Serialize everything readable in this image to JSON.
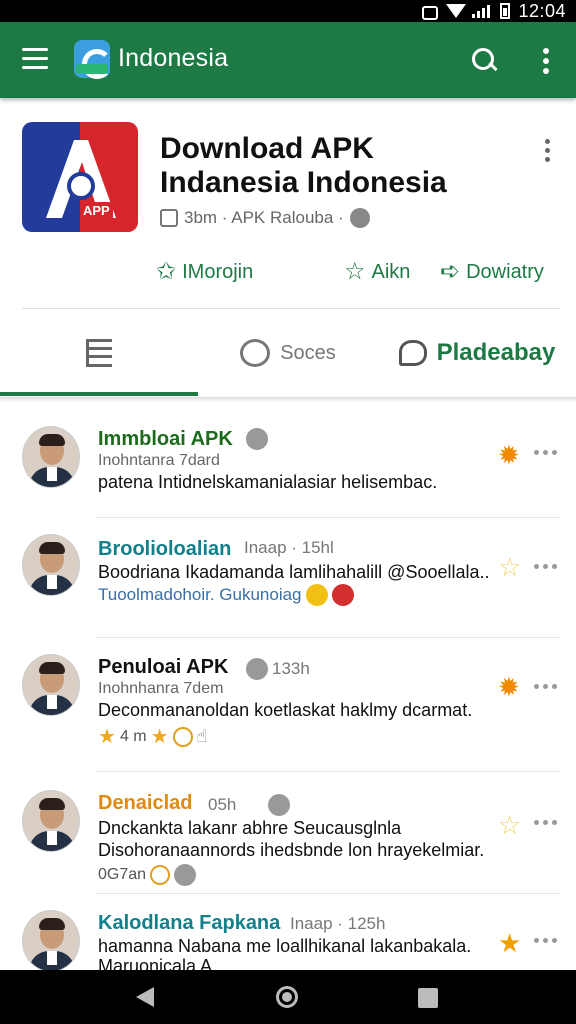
{
  "status_bar": {
    "time": "12:04",
    "icons": [
      "mute-icon",
      "wifi-icon",
      "signal-icon",
      "battery-icon"
    ]
  },
  "app_bar": {
    "title": "Indonesia",
    "icons": [
      "menu-icon",
      "app-logo-icon",
      "search-icon",
      "more-vert-icon"
    ],
    "color": "#1e7a44"
  },
  "app_header": {
    "title": "Download APK Indanesia Indonesia",
    "icon_tag": "APP",
    "meta": "3bm · APK Ralouba ·",
    "actions": [
      {
        "label": "IMorojin",
        "icon": "star-badge-icon"
      },
      {
        "label": "Aikn",
        "icon": "star-outline-icon"
      },
      {
        "label": "Dowiatry",
        "icon": "share-icon"
      }
    ]
  },
  "tabs": [
    {
      "label": "",
      "icon": "list-icon",
      "active": false
    },
    {
      "label": "Soces",
      "icon": "chat-icon",
      "active": false
    },
    {
      "label": "Pladeabay",
      "icon": "comment-icon",
      "active": true
    }
  ],
  "feed": [
    {
      "name": "Immbloai APK",
      "name_color": "#1c6a1c",
      "meta": "",
      "sub": "Inohntanra 7dard",
      "lines": [
        "patena Intidnelskamanialasiar helisembac."
      ],
      "foot": "",
      "rating_icon": "gear-icon",
      "rating_glyph": "✹"
    },
    {
      "name": "Broolioloalian",
      "name_color": "#12808a",
      "meta": "Inaap · 15hl",
      "sub": "",
      "lines": [
        "Boodriana Ikadamanda lamlihahalill @Sooellala..",
        "Tuoolmadohoir. Gukunoiag"
      ],
      "foot": "",
      "rating_icon": "star-outline-icon",
      "rating_glyph": "☆"
    },
    {
      "name": "Penuloai APK",
      "name_color": "#111111",
      "meta": "133h",
      "sub": "Inohnhanra 7dem",
      "lines": [
        "Deconmananoldan koetlaskat haklmy dcarmat."
      ],
      "foot": "4 m",
      "rating_icon": "gear-icon",
      "rating_glyph": "✹"
    },
    {
      "name": "Denaiclad",
      "name_color": "#e08a10",
      "meta": "05h",
      "sub": "",
      "lines": [
        "Dnckankta lakanr abhre Seucausglnla",
        "Disohoranaannords ihedsbnde lon hrayekelmiar."
      ],
      "foot": "0G7an",
      "rating_icon": "star-outline-icon",
      "rating_glyph": "☆"
    },
    {
      "name": "Kalodlana Fapkana",
      "name_color": "#12808a",
      "meta": "Inaap · 125h",
      "sub": "",
      "lines": [
        "hamanna Nabana me loallhikanal lakanbakala.",
        "Maruonicala A"
      ],
      "foot": "",
      "rating_icon": "star-icon",
      "rating_glyph": "★"
    }
  ],
  "nav_bar": {
    "icons": [
      "back-icon",
      "home-icon",
      "recents-icon"
    ]
  }
}
